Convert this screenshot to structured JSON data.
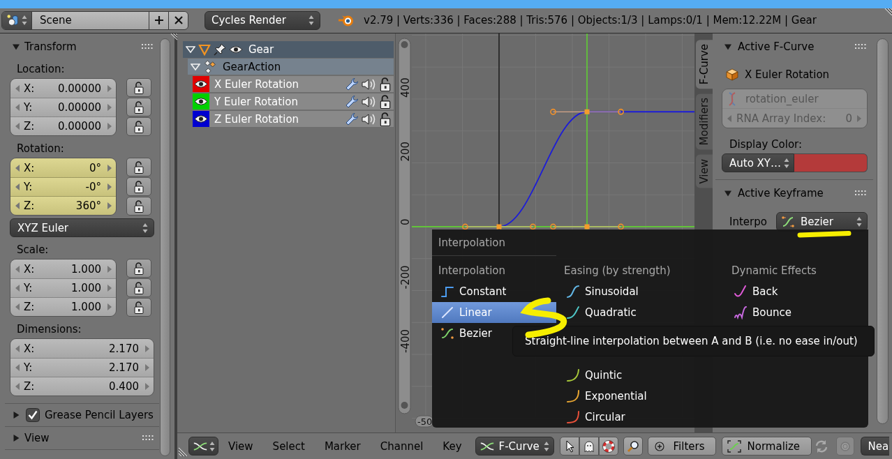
{
  "info_header": {
    "scene": "Scene",
    "render_engine": "Cycles Render",
    "stats": "v2.79 | Verts:336 | Faces:288 | Tris:576 | Objects:1/3 | Lamps:0/1 | Mem:12.22M | Gear"
  },
  "properties": {
    "transform": {
      "title": "Transform",
      "expanded": true,
      "groups": [
        {
          "kind": "lock-vector",
          "label": "Location:",
          "fields": [
            {
              "axis": "X:",
              "value": "0.00000",
              "keyed": false,
              "locked": false
            },
            {
              "axis": "Y:",
              "value": "0.00000",
              "keyed": false,
              "locked": false
            },
            {
              "axis": "Z:",
              "value": "0.00000",
              "keyed": false,
              "locked": false
            }
          ]
        },
        {
          "kind": "lock-vector",
          "label": "Rotation:",
          "fields": [
            {
              "axis": "X:",
              "value": "0°",
              "keyed": true,
              "locked": false
            },
            {
              "axis": "Y:",
              "value": "-0°",
              "keyed": true,
              "locked": false
            },
            {
              "axis": "Z:",
              "value": "360°",
              "keyed": true,
              "locked": false
            }
          ]
        },
        {
          "kind": "dropdown",
          "value": "XYZ Euler"
        },
        {
          "kind": "lock-vector",
          "label": "Scale:",
          "fields": [
            {
              "axis": "X:",
              "value": "1.000",
              "keyed": false,
              "locked": false
            },
            {
              "axis": "Y:",
              "value": "1.000",
              "keyed": false,
              "locked": false
            },
            {
              "axis": "Z:",
              "value": "1.000",
              "keyed": false,
              "locked": false
            }
          ]
        },
        {
          "kind": "vector",
          "label": "Dimensions:",
          "fields": [
            {
              "axis": "X:",
              "value": "2.170",
              "keyed": false
            },
            {
              "axis": "Y:",
              "value": "2.170",
              "keyed": false
            },
            {
              "axis": "Z:",
              "value": "0.400",
              "keyed": false
            }
          ]
        }
      ]
    },
    "collapsed_panels": [
      {
        "title": "Grease Pencil Layers",
        "expanded": false,
        "checked": true
      },
      {
        "title": "View",
        "expanded": false
      }
    ]
  },
  "channels": [
    {
      "kind": "object",
      "name": "Gear",
      "expanded": true,
      "children": [
        {
          "kind": "action",
          "name": "GearAction",
          "expanded": true,
          "children": [
            {
              "kind": "fcurve",
              "name": "X Euler Rotation",
              "color": "#e00000"
            },
            {
              "kind": "fcurve",
              "name": "Y Euler Rotation",
              "color": "#00d000"
            },
            {
              "kind": "fcurve",
              "name": "Z Euler Rotation",
              "color": "#0000d0"
            }
          ]
        }
      ]
    }
  ],
  "graph": {
    "value_labels": [
      "400",
      "200",
      "0",
      "-200",
      "-400"
    ],
    "frame_label": "-50"
  },
  "sidebar_tabs": [
    {
      "label": "F-Curve",
      "selected": true
    },
    {
      "label": "Modifiers",
      "selected": false
    },
    {
      "label": "View",
      "selected": false
    }
  ],
  "active_fcurve": {
    "title": "Active F-Curve",
    "expanded": true,
    "channel": "X Euler Rotation",
    "path_fields": {
      "disabled": true,
      "data_path": "rotation_euler",
      "index_label": "RNA Array Index:",
      "index": "0"
    },
    "display_color": {
      "label": "Display Color:",
      "mode": "Auto XY…",
      "color": "#b43a3a"
    }
  },
  "active_keyframe": {
    "title": "Active Keyframe",
    "expanded": true,
    "interpolation_label": "Interpo",
    "interpolation": "Bezier"
  },
  "interpolation_menu": {
    "title": "Interpolation",
    "columns": [
      {
        "heading": "Interpolation",
        "items": [
          {
            "kind": "constant",
            "label": "Constant",
            "selected": false
          },
          {
            "kind": "linear",
            "label": "Linear",
            "selected": true
          },
          {
            "kind": "bezier",
            "label": "Bezier",
            "selected": false
          }
        ]
      },
      {
        "heading": "Easing (by strength)",
        "items": [
          {
            "kind": "sine",
            "label": "Sinusoidal",
            "selected": false
          },
          {
            "kind": "quad",
            "label": "Quadratic",
            "selected": false
          }
        ],
        "lower_items": [
          {
            "kind": "quint",
            "label": "Quintic",
            "selected": false
          },
          {
            "kind": "expo",
            "label": "Exponential",
            "selected": false
          },
          {
            "kind": "circ",
            "label": "Circular",
            "selected": false
          }
        ]
      },
      {
        "heading": "Dynamic Effects",
        "items": [
          {
            "kind": "back",
            "label": "Back",
            "selected": false
          },
          {
            "kind": "bounce",
            "label": "Bounce",
            "selected": false
          }
        ]
      }
    ]
  },
  "tooltip": {
    "text": "Straight-line interpolation between A and B (i.e. no ease in/out)"
  },
  "bottom_header": {
    "menus": [
      "View",
      "Select",
      "Marker",
      "Channel",
      "Key"
    ],
    "mode": "F-Curve",
    "filters": "Filters",
    "normalize": {
      "label": "Normalize",
      "on": false
    },
    "pivot": "Nea"
  }
}
